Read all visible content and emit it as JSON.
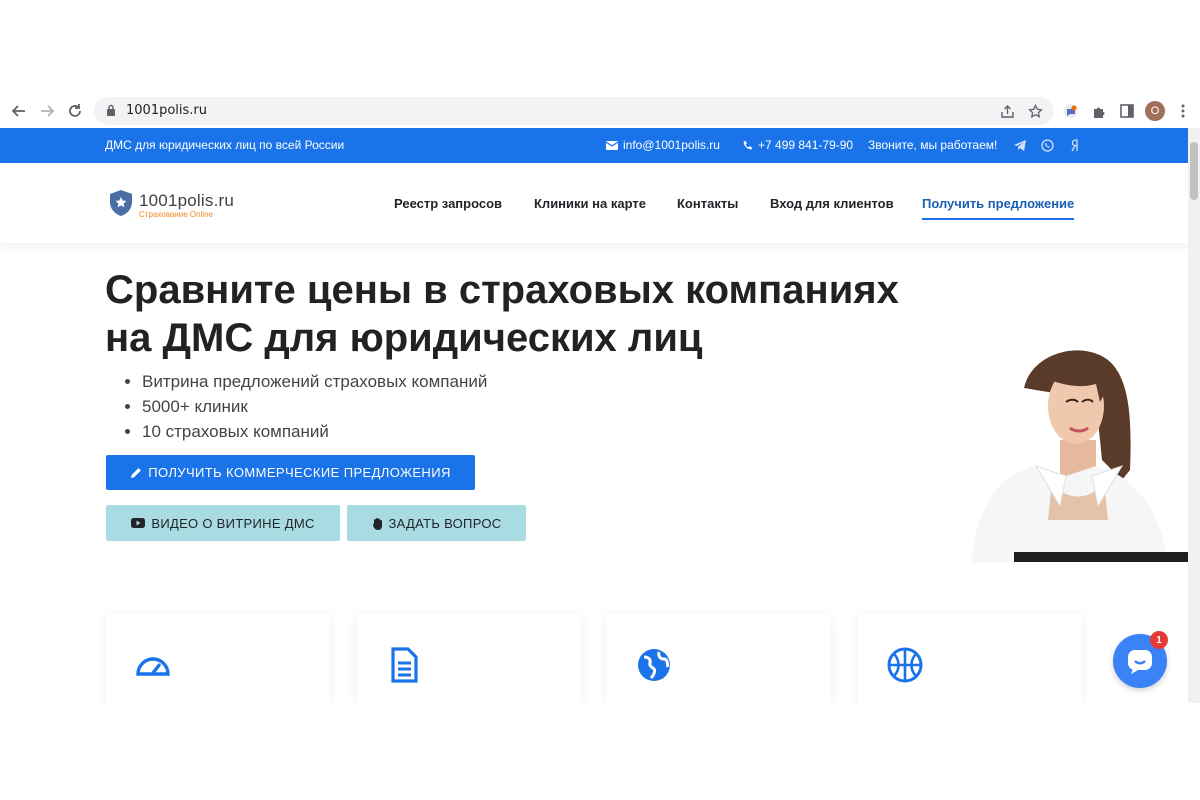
{
  "browser": {
    "url": "1001polis.ru",
    "profile_initial": "O",
    "icons": [
      "back-icon",
      "forward-icon",
      "reload-icon",
      "lock-icon",
      "share-icon",
      "star-icon",
      "extension-icon",
      "puzzle-icon",
      "sidepanel-icon",
      "menu-icon"
    ]
  },
  "topbar": {
    "tagline": "ДМС для юридических лиц по всей России",
    "email": "info@1001polis.ru",
    "phone": "+7 499 841-79-90",
    "worktime": "Звоните, мы работаем!",
    "social_icons": [
      "telegram-icon",
      "whatsapp-icon",
      "yandex-icon"
    ]
  },
  "header": {
    "logo_title": "1001polis.ru",
    "logo_subtitle": "Страхование Online",
    "menu": [
      {
        "label": "Реестр запросов"
      },
      {
        "label": "Клиники на карте"
      },
      {
        "label": "Контакты"
      },
      {
        "label": "Вход для клиентов"
      },
      {
        "label": "Получить предложение"
      }
    ]
  },
  "hero": {
    "title_line1": "Сравните цены в страховых компаниях",
    "title_line2": "на ДМС для юридических лиц",
    "bullets": [
      "Витрина предложений страховых компаний",
      "5000+ клиник",
      "10 страховых компаний"
    ],
    "primary_button": "ПОЛУЧИТЬ КОММЕРЧЕСКИЕ ПРЕДЛОЖЕНИЯ",
    "video_button": "ВИДЕО О ВИТРИНЕ ДМС",
    "question_button": "ЗАДАТЬ ВОПРОС"
  },
  "features": {
    "icons": [
      "speedometer-icon",
      "document-icon",
      "globe-icon",
      "basketball-icon"
    ]
  },
  "chat": {
    "badge_count": "1"
  },
  "colors": {
    "brand_blue": "#1a73e8",
    "secondary_button": "#a9dbe2",
    "logo_accent": "#f08a24",
    "badge": "#e53935"
  }
}
